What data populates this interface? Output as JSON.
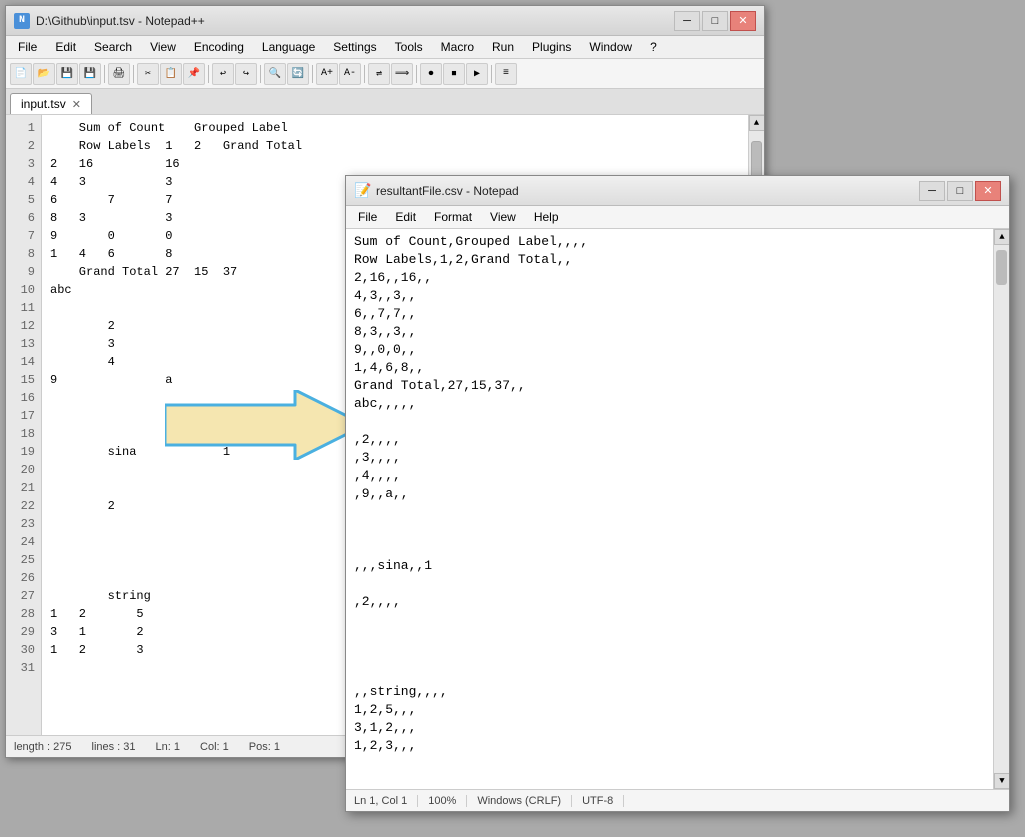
{
  "npp_window": {
    "title": "D:\\Github\\input.tsv - Notepad++",
    "tab_label": "input.tsv",
    "menu_items": [
      "File",
      "Edit",
      "Search",
      "View",
      "Encoding",
      "Language",
      "Settings",
      "Tools",
      "Macro",
      "Run",
      "Plugins",
      "Window",
      "?"
    ],
    "close_btn": "✕",
    "min_btn": "─",
    "max_btn": "□",
    "code_lines": [
      "    Sum of Count    Grouped Label",
      "    Row Labels  1   2   Grand Total",
      "2   16          16",
      "4   3           3",
      "6       7       7",
      "8   3           3",
      "9       0       0",
      "1   4   6       8",
      "    Grand Total 27  15  37",
      "abc",
      "",
      "        2",
      "        3",
      "        4",
      "9               a",
      "",
      "",
      "",
      "",
      "        sina            1",
      "",
      "",
      "        2",
      "",
      "",
      "",
      "        string",
      "1   2       5",
      "3   1       2",
      "1   2       3",
      ""
    ],
    "line_count": 31,
    "length": 275,
    "status_ln": "Ln: 1",
    "status_col": "Col: 1",
    "status_pos": "Pos: 1"
  },
  "notepad_window": {
    "title": "resultantFile.csv - Notepad",
    "menu_items": [
      "File",
      "Edit",
      "Format",
      "View",
      "Help"
    ],
    "close_btn": "✕",
    "min_btn": "─",
    "max_btn": "□",
    "code_content": "Sum of Count,Grouped Label,,,,\nRow Labels,1,2,Grand Total,,\n2,16,,16,,\n4,3,,3,,\n6,,7,7,,\n8,3,,3,,\n9,,0,0,,\n1,4,6,8,,\nGrand Total,27,15,37,,\nabc,,,,,\n\n,2,,,,\n,3,,,,\n,4,,,,\n,9,,a,,\n\n\n\n\n,,,sina,,1\n\n,2,,,,\n\n\n\n\n,,string,,,,\n1,2,5,,,\n3,1,2,,,\n1,2,3,,,",
    "status_ln_col": "Ln 1, Col 1",
    "status_zoom": "100%",
    "status_eol": "Windows (CRLF)",
    "status_encoding": "UTF-8"
  },
  "arrow": {
    "color": "#f5e6b0",
    "border_color": "#4ab0e0"
  }
}
